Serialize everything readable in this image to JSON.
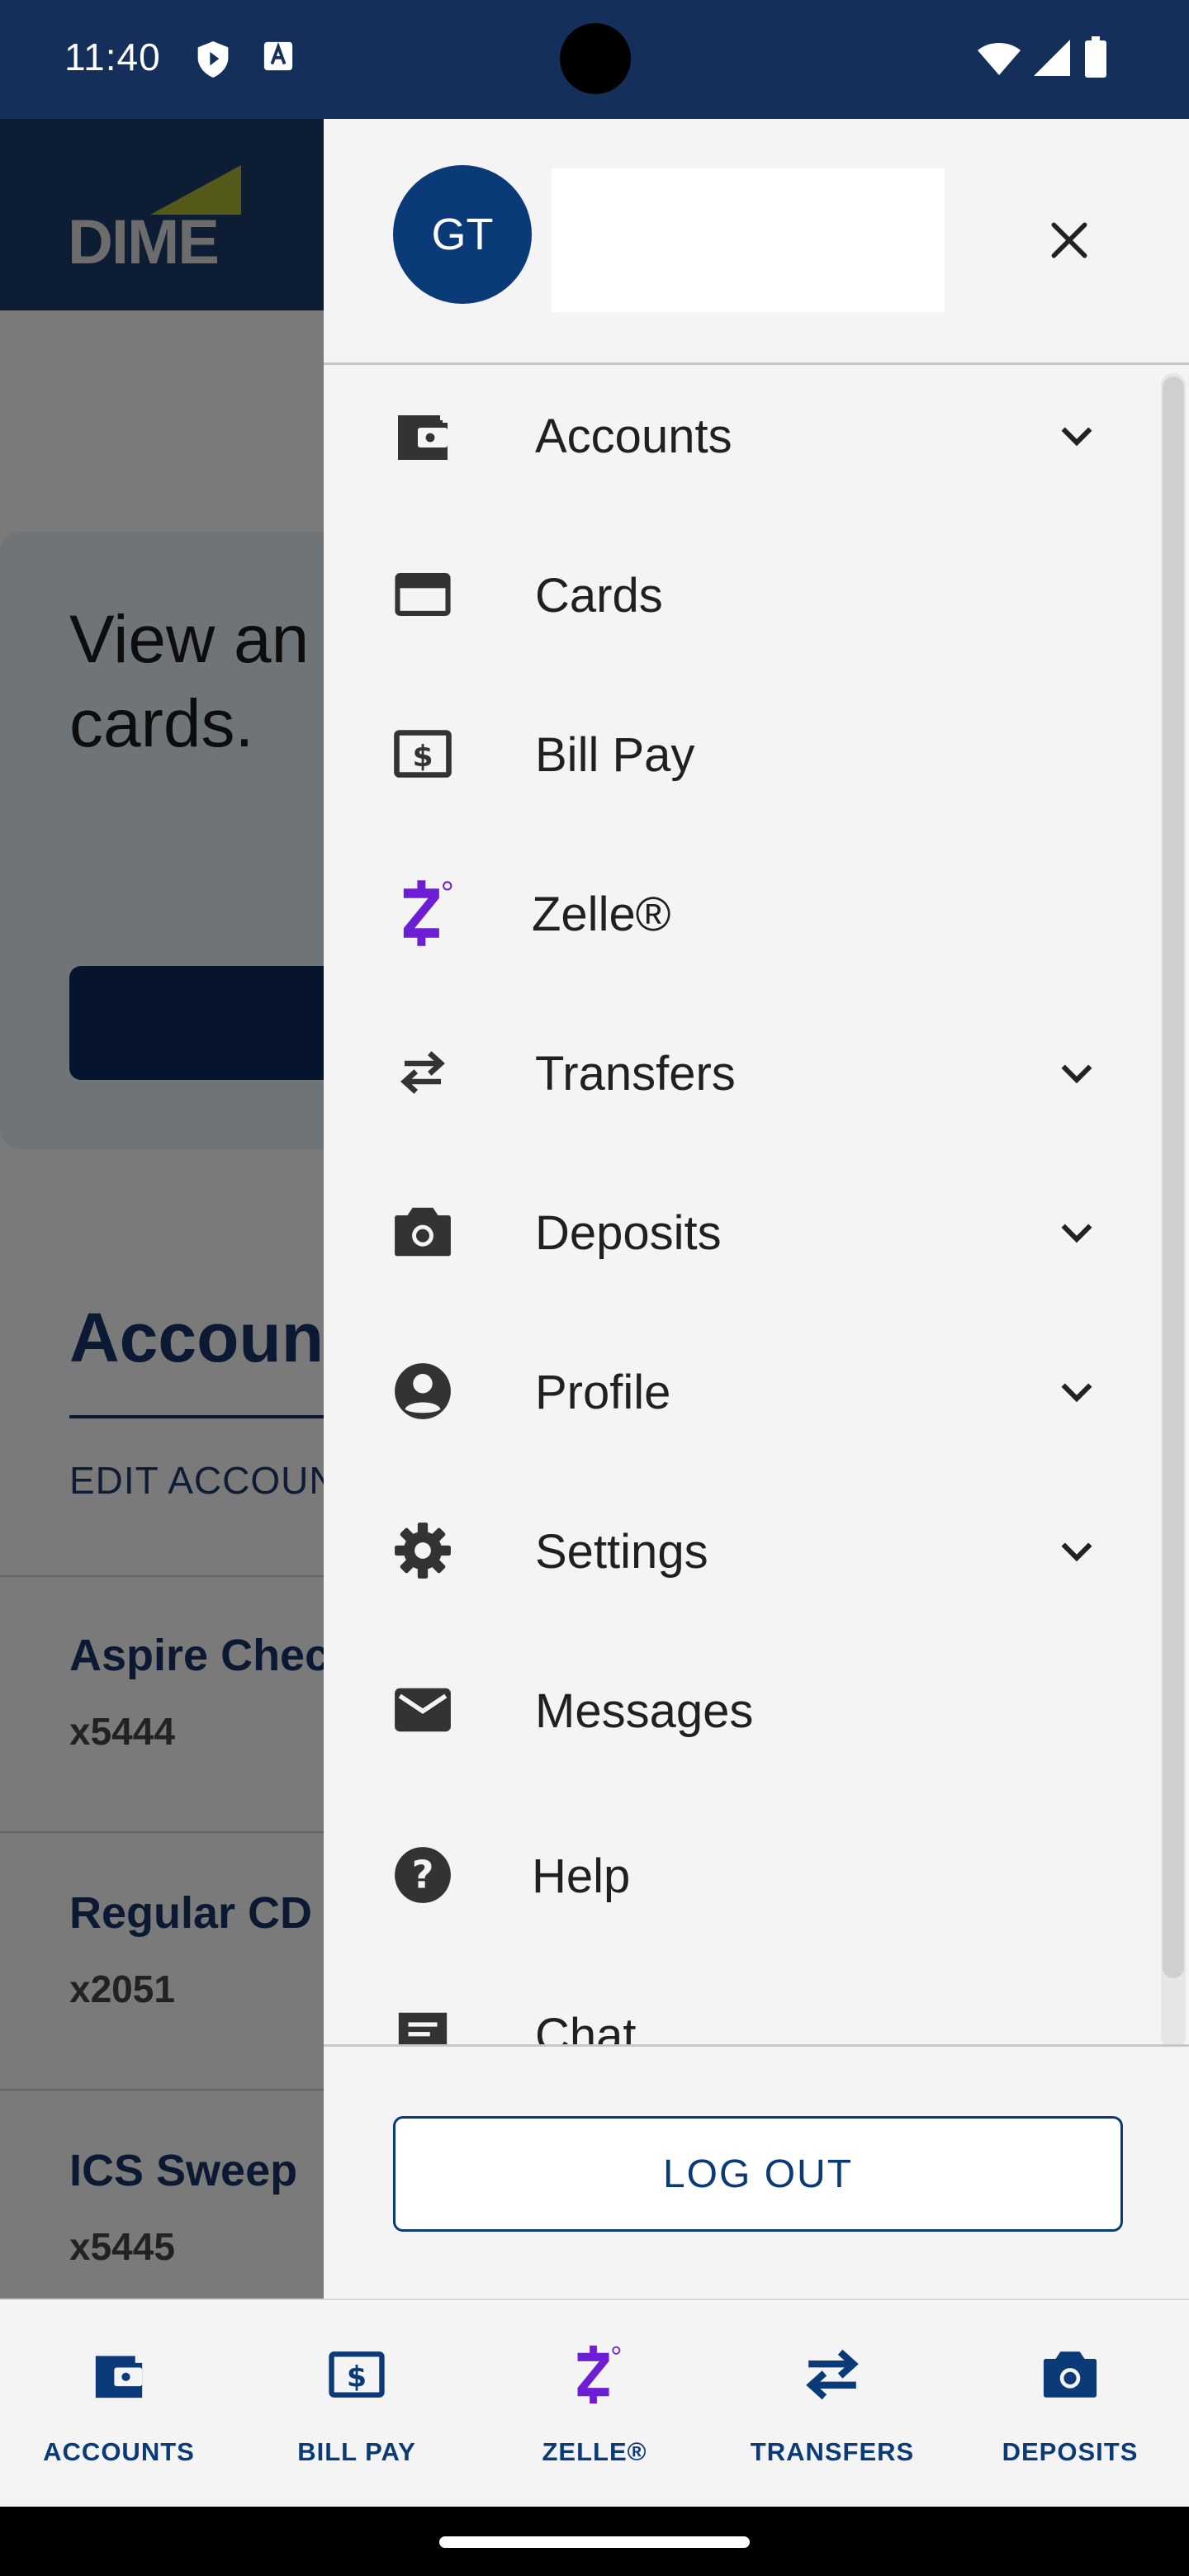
{
  "status_bar": {
    "time": "11:40"
  },
  "background": {
    "logo_text": "DIME",
    "promo_line1": "View an",
    "promo_line2": "cards.",
    "accounts_title": "Account",
    "edit_link": "EDIT ACCOUN",
    "accounts": [
      {
        "name": "Aspire Chec",
        "number": "x5444"
      },
      {
        "name": "Regular CD",
        "number": "x2051"
      },
      {
        "name": "ICS Sweep",
        "number": "x5445"
      }
    ]
  },
  "drawer": {
    "avatar_initials": "GT",
    "menu": [
      {
        "label": "Accounts",
        "icon": "wallet-icon",
        "expandable": true
      },
      {
        "label": "Cards",
        "icon": "credit-card-icon",
        "expandable": false
      },
      {
        "label": "Bill Pay",
        "icon": "bill-pay-icon",
        "expandable": false
      },
      {
        "label": "Zelle®",
        "icon": "zelle-icon",
        "expandable": false
      },
      {
        "label": "Transfers",
        "icon": "transfer-arrows-icon",
        "expandable": true
      },
      {
        "label": "Deposits",
        "icon": "camera-icon",
        "expandable": true
      },
      {
        "label": "Profile",
        "icon": "account-circle-icon",
        "expandable": true
      },
      {
        "label": "Settings",
        "icon": "gear-icon",
        "expandable": true
      },
      {
        "label": "Messages",
        "icon": "envelope-icon",
        "expandable": false
      },
      {
        "label": "Help",
        "icon": "help-circle-icon",
        "expandable": false
      },
      {
        "label": "Chat",
        "icon": "chat-icon",
        "expandable": false
      }
    ],
    "logout_label": "LOG OUT"
  },
  "bottom_nav": [
    {
      "label": "ACCOUNTS",
      "icon": "wallet-icon"
    },
    {
      "label": "BILL PAY",
      "icon": "bill-pay-icon"
    },
    {
      "label": "ZELLE®",
      "icon": "zelle-icon"
    },
    {
      "label": "TRANSFERS",
      "icon": "transfer-arrows-icon"
    },
    {
      "label": "DEPOSITS",
      "icon": "camera-icon"
    }
  ],
  "colors": {
    "brand_navy": "#0b3a78",
    "zelle_purple": "#6d1ed4",
    "status_bar": "#132f5a"
  }
}
